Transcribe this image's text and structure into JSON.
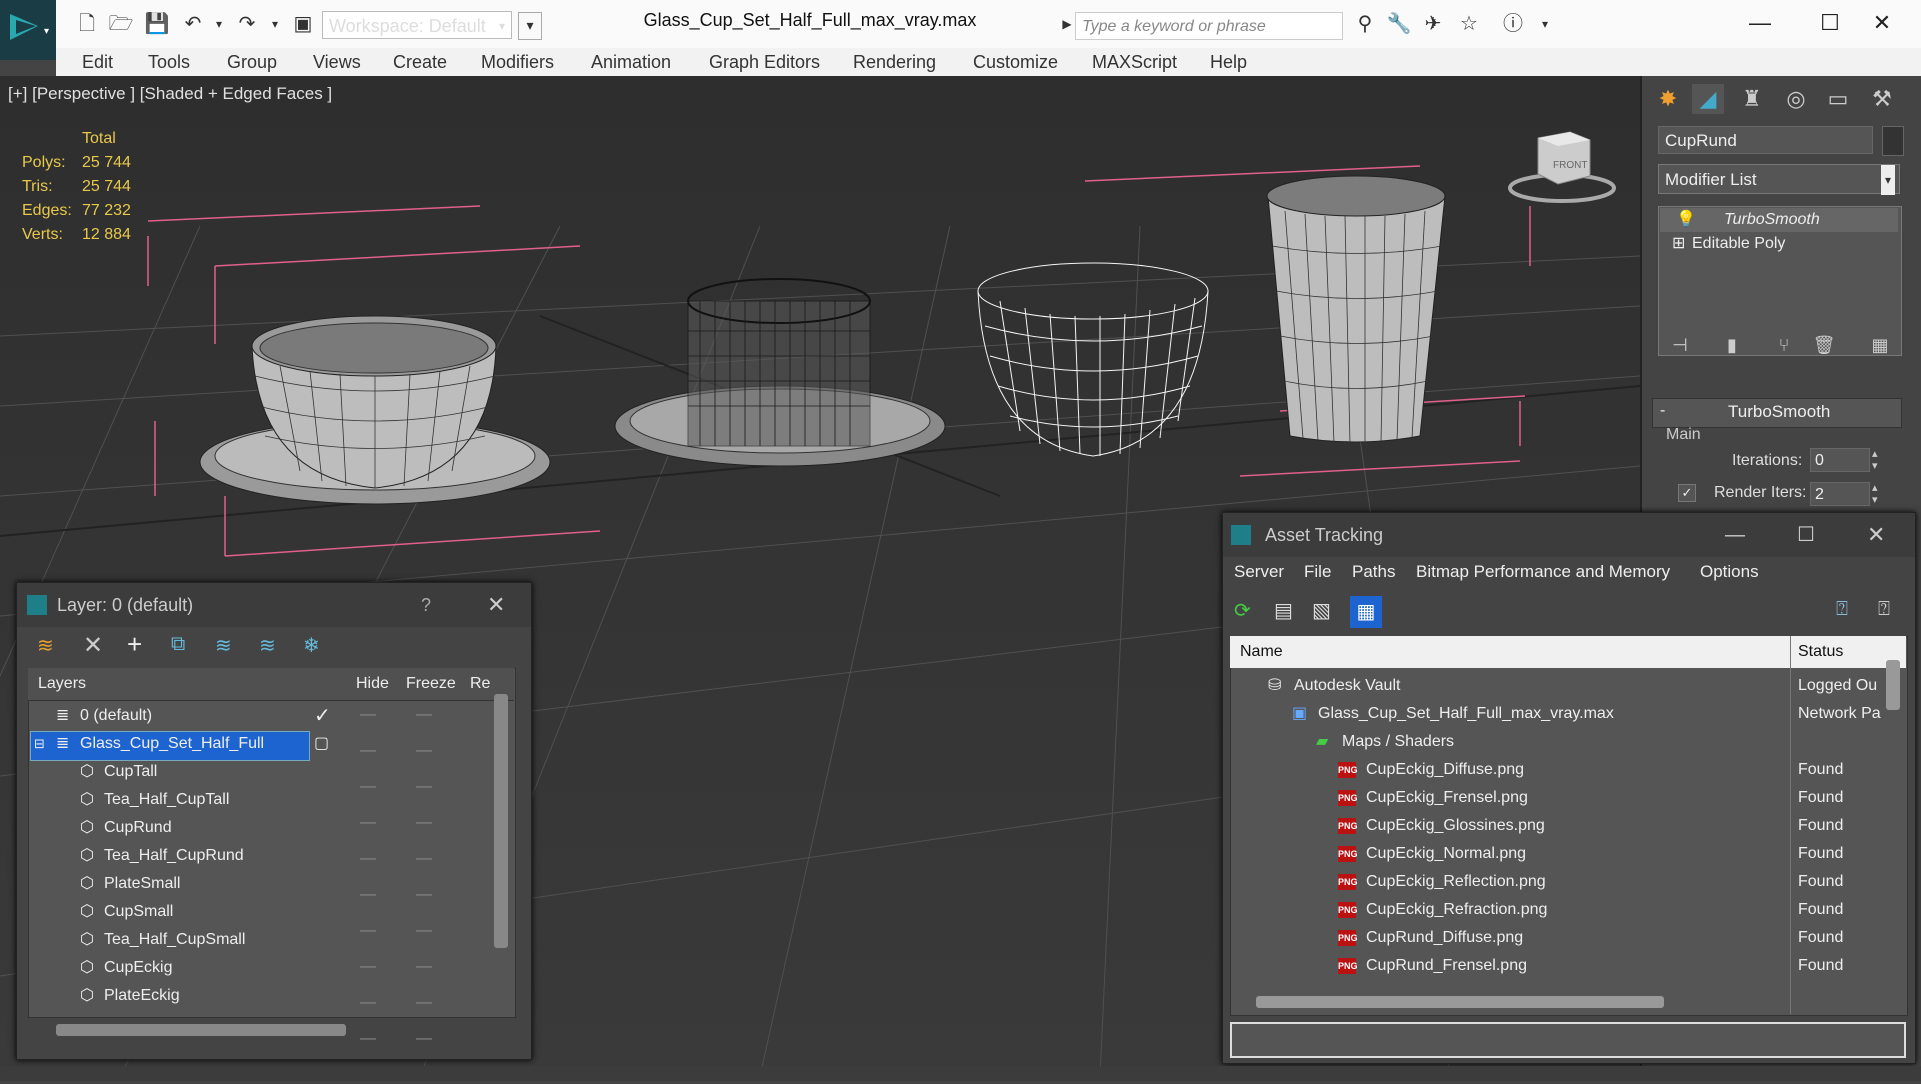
{
  "titlebar": {
    "workspace": "Workspace: Default",
    "file_title": "Glass_Cup_Set_Half_Full_max_vray.max",
    "search_placeholder": "Type a keyword or phrase"
  },
  "menu": [
    "Edit",
    "Tools",
    "Group",
    "Views",
    "Create",
    "Modifiers",
    "Animation",
    "Graph Editors",
    "Rendering",
    "Customize",
    "MAXScript",
    "Help"
  ],
  "viewport": {
    "label": "[+] [Perspective ] [Shaded + Edged Faces ]",
    "stats_header": "Total",
    "stats": [
      {
        "label": "Polys:",
        "value": "25 744"
      },
      {
        "label": "Tris:",
        "value": "25 744"
      },
      {
        "label": "Edges:",
        "value": "77 232"
      },
      {
        "label": "Verts:",
        "value": "12 884"
      }
    ],
    "viewcube_label": "FRONT"
  },
  "command_panel": {
    "object_name": "CupRund",
    "modifier_list": "Modifier List",
    "stack": [
      "TurboSmooth",
      "Editable Poly"
    ],
    "rollout_title": "TurboSmooth",
    "group_main": "Main",
    "iterations_label": "Iterations:",
    "iterations_value": "0",
    "render_iters_label": "Render Iters:",
    "render_iters_value": "2"
  },
  "layer_dialog": {
    "title": "Layer: 0 (default)",
    "help": "?",
    "columns": [
      "Layers",
      "Hide",
      "Freeze",
      "Re"
    ],
    "rows": [
      {
        "name": "0 (default)",
        "level": 1
      },
      {
        "name": "Glass_Cup_Set_Half_Full",
        "level": 1
      },
      {
        "name": "CupTall",
        "level": 2
      },
      {
        "name": "Tea_Half_CupTall",
        "level": 2
      },
      {
        "name": "CupRund",
        "level": 2
      },
      {
        "name": "Tea_Half_CupRund",
        "level": 2
      },
      {
        "name": "PlateSmall",
        "level": 2
      },
      {
        "name": "CupSmall",
        "level": 2
      },
      {
        "name": "Tea_Half_CupSmall",
        "level": 2
      },
      {
        "name": "CupEckig",
        "level": 2
      },
      {
        "name": "PlateEckig",
        "level": 2
      }
    ]
  },
  "asset_dialog": {
    "title": "Asset Tracking",
    "menu": [
      "Server",
      "File",
      "Paths",
      "Bitmap Performance and Memory",
      "Options"
    ],
    "columns": [
      "Name",
      "Status"
    ],
    "rows": [
      {
        "name": "Autodesk Vault",
        "status": "Logged Ou",
        "level": 1,
        "icon": "vault"
      },
      {
        "name": "Glass_Cup_Set_Half_Full_max_vray.max",
        "status": "Network Pa",
        "level": 2,
        "icon": "max"
      },
      {
        "name": "Maps / Shaders",
        "status": "",
        "level": 3,
        "icon": "maps"
      },
      {
        "name": "CupEckig_Diffuse.png",
        "status": "Found",
        "level": 4,
        "icon": "png"
      },
      {
        "name": "CupEckig_Frensel.png",
        "status": "Found",
        "level": 4,
        "icon": "png"
      },
      {
        "name": "CupEckig_Glossines.png",
        "status": "Found",
        "level": 4,
        "icon": "png"
      },
      {
        "name": "CupEckig_Normal.png",
        "status": "Found",
        "level": 4,
        "icon": "png"
      },
      {
        "name": "CupEckig_Reflection.png",
        "status": "Found",
        "level": 4,
        "icon": "png"
      },
      {
        "name": "CupEckig_Refraction.png",
        "status": "Found",
        "level": 4,
        "icon": "png"
      },
      {
        "name": "CupRund_Diffuse.png",
        "status": "Found",
        "level": 4,
        "icon": "png"
      },
      {
        "name": "CupRund_Frensel.png",
        "status": "Found",
        "level": 4,
        "icon": "png"
      }
    ],
    "png_badge": "PNG"
  }
}
